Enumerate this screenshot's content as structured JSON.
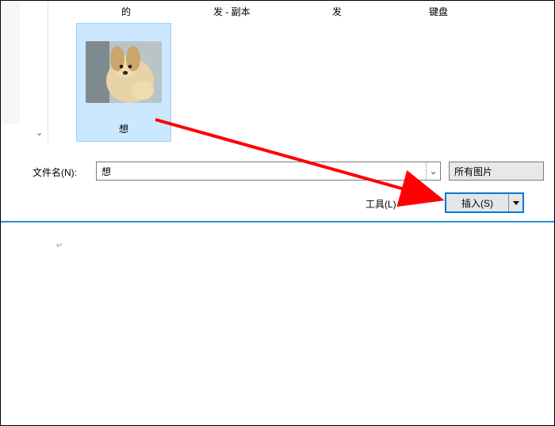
{
  "labels": {
    "l1": "的",
    "l2": "发 - 副本",
    "l3": "发",
    "l4": "键盘"
  },
  "thumbnail": {
    "caption": "想"
  },
  "filename": {
    "label": "文件名(N):",
    "value": "想"
  },
  "filter": {
    "label": "所有图片"
  },
  "tools": {
    "label": "工具(L)"
  },
  "insert": {
    "label": "插入(S)"
  },
  "doc": {
    "para_mark": "↵"
  }
}
